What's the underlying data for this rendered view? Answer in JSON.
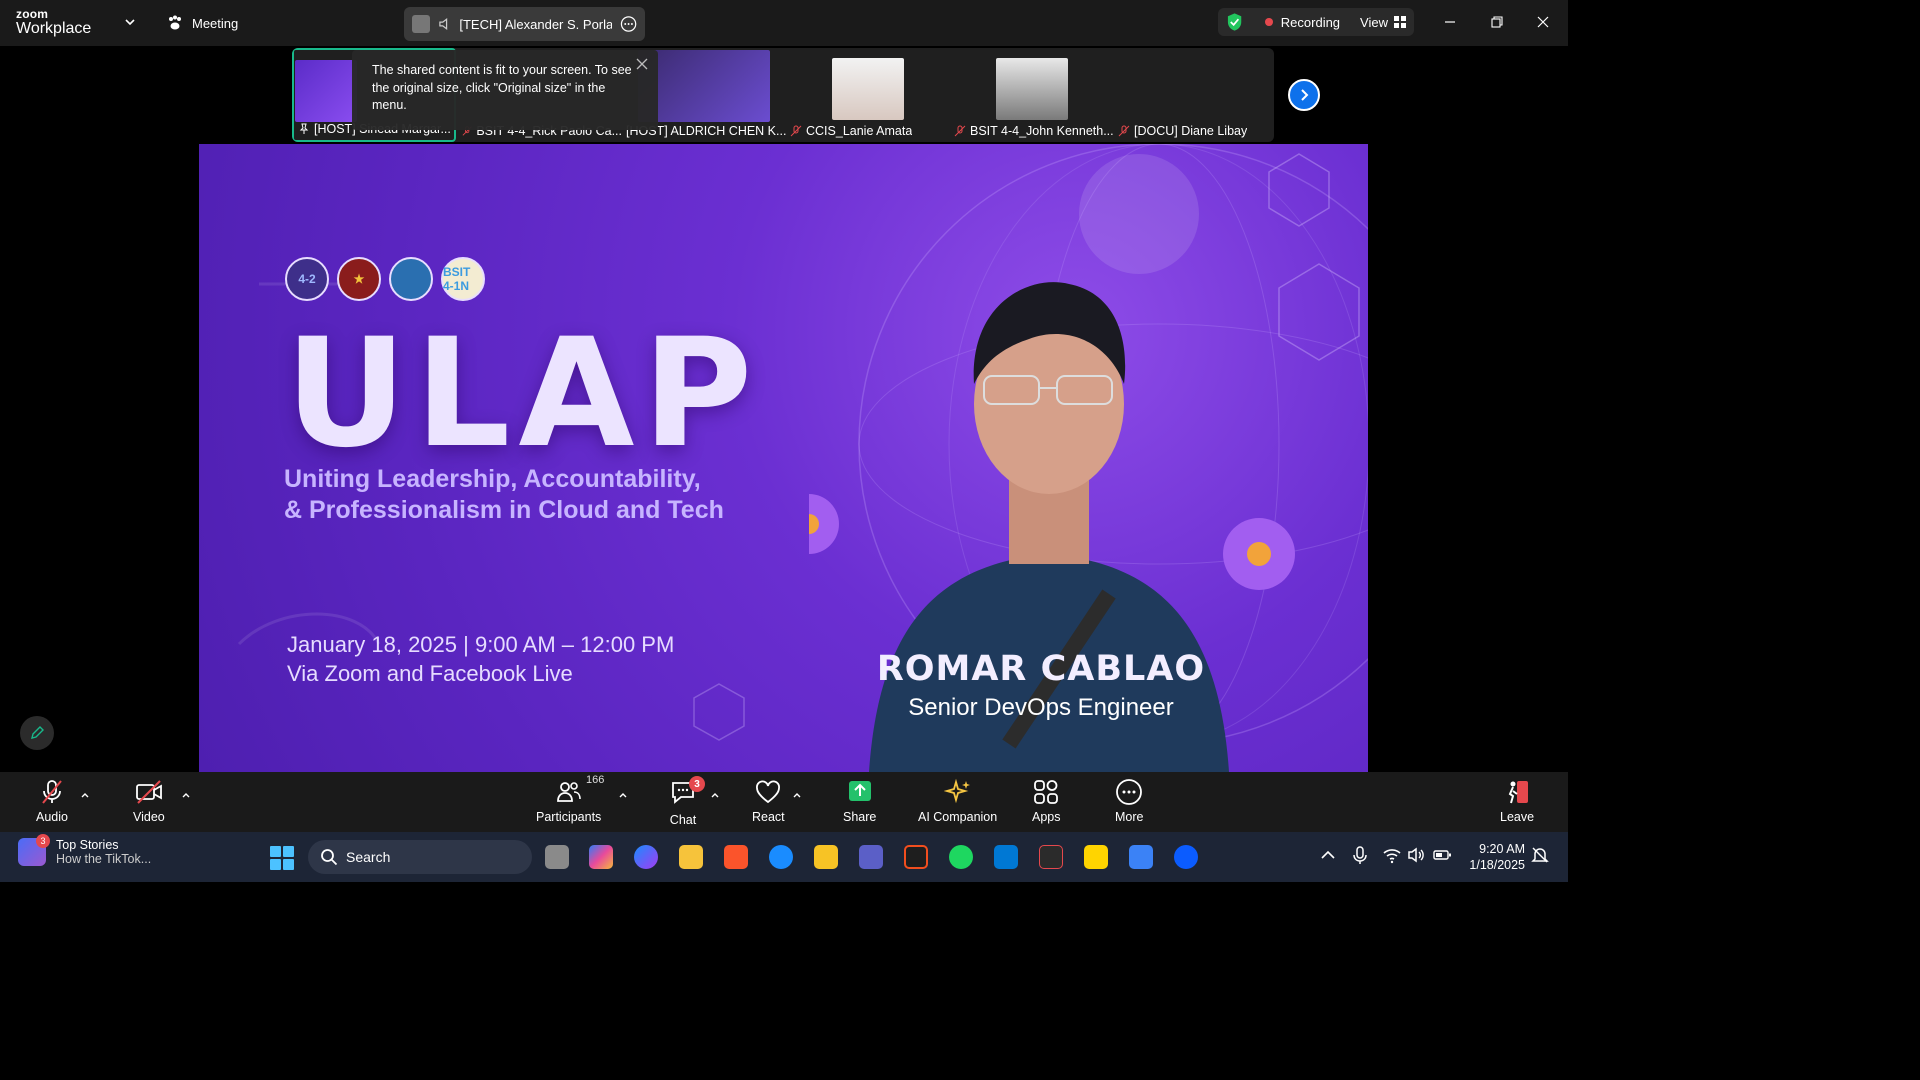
{
  "titlebar": {
    "brand_top": "zoom",
    "brand_bottom": "Workplace",
    "meeting_label": "Meeting",
    "active_speaker": "[TECH] Alexander S. Porlares",
    "recording_label": "Recording",
    "view_label": "View"
  },
  "strip": {
    "thumbnails": [
      {
        "label": "[HOST] Sinead Margar..."
      },
      {
        "label": "BSIT 4-4_Rick Paolo Ca..."
      },
      {
        "label": "[HOST] ALDRICH CHEN K..."
      },
      {
        "label": "CCIS_Lanie Amata"
      },
      {
        "label": "BSIT 4-4_John Kenneth..."
      },
      {
        "label": "[DOCU] Diane Libay"
      }
    ],
    "tooltip": "The shared content is fit to your screen. To see the original size, click \"Original size\" in the menu."
  },
  "slide": {
    "logos": [
      "4-2",
      "★",
      "",
      "BSIT 4-1N"
    ],
    "title": "ULAP",
    "tagline_1": "Uniting Leadership, Accountability,",
    "tagline_2": "& Professionalism in Cloud and Tech",
    "date_line": "January 18, 2025  |  9:00 AM – 12:00 PM",
    "via_line": "Via Zoom and Facebook Live",
    "speaker_name": "ROMAR CABLAO",
    "speaker_role": "Senior DevOps Engineer"
  },
  "toolbar": {
    "audio": "Audio",
    "video": "Video",
    "participants": "Participants",
    "participants_count": "166",
    "chat": "Chat",
    "chat_badge": "3",
    "react": "React",
    "share": "Share",
    "ai": "AI Companion",
    "apps": "Apps",
    "more": "More",
    "leave": "Leave"
  },
  "taskbar": {
    "news_badge": "3",
    "news_title": "Top Stories",
    "news_sub": "How the TikTok...",
    "search_label": "Search",
    "time": "9:20 AM",
    "date": "1/18/2025"
  },
  "colors": {
    "accent_green": "#18b98b",
    "zoom_blue": "#0e71eb",
    "slide_purple": "#6b2fd2",
    "recording_red": "#e5484d"
  }
}
